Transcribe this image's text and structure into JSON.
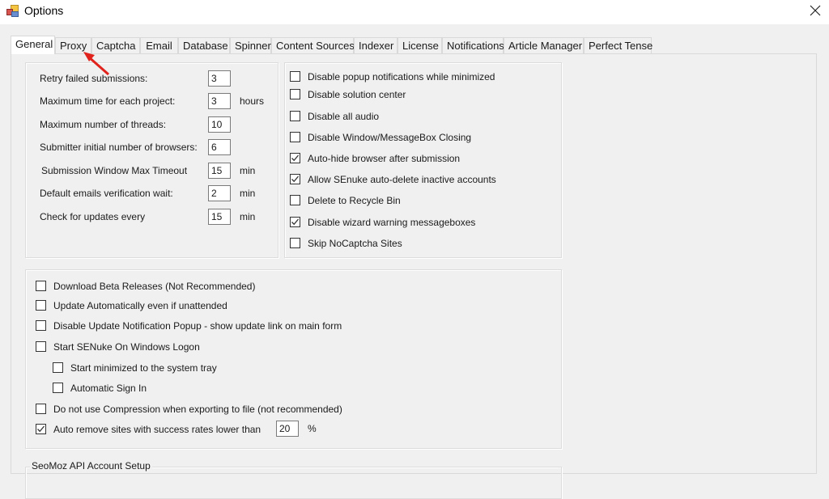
{
  "window": {
    "title": "Options",
    "icon": "options-app-icon",
    "close_icon": "close-icon"
  },
  "tabs": [
    {
      "label": "General",
      "active": true
    },
    {
      "label": "Proxy",
      "active": false
    },
    {
      "label": "Captcha",
      "active": false
    },
    {
      "label": "Email",
      "active": false
    },
    {
      "label": "Database",
      "active": false
    },
    {
      "label": "Spinner",
      "active": false
    },
    {
      "label": "Content Sources",
      "active": false
    },
    {
      "label": "Indexer",
      "active": false
    },
    {
      "label": "License",
      "active": false
    },
    {
      "label": "Notifications",
      "active": false
    },
    {
      "label": "Article Manager",
      "active": false
    },
    {
      "label": "Perfect Tense",
      "active": false
    }
  ],
  "settings": [
    {
      "label": "Retry failed submissions:",
      "value": "3",
      "unit": ""
    },
    {
      "label": "Maximum time for each project:",
      "value": "3",
      "unit": "hours"
    },
    {
      "label": "Maximum number of threads:",
      "value": "10",
      "unit": ""
    },
    {
      "label": "Submitter initial number of browsers:",
      "value": "6",
      "unit": ""
    },
    {
      "label": "Submission Window Max Timeout",
      "value": "15",
      "unit": "min"
    },
    {
      "label": "Default emails verification wait:",
      "value": "2",
      "unit": "min"
    },
    {
      "label": "Check for updates every",
      "value": "15",
      "unit": "min"
    }
  ],
  "general_options": [
    {
      "label": "Disable popup notifications while minimized",
      "checked": false
    },
    {
      "label": "Disable solution center",
      "checked": false
    },
    {
      "label": "Disable all audio",
      "checked": false
    },
    {
      "label": "Disable Window/MessageBox Closing",
      "checked": false
    },
    {
      "label": "Auto-hide browser after submission",
      "checked": true
    },
    {
      "label": "Allow SEnuke auto-delete inactive accounts",
      "checked": true
    },
    {
      "label": "Delete to Recycle Bin",
      "checked": false
    },
    {
      "label": "Disable wizard warning messageboxes",
      "checked": true
    },
    {
      "label": "Skip NoCaptcha Sites",
      "checked": false
    }
  ],
  "update_options": [
    {
      "label": "Download Beta Releases (Not Recommended)",
      "checked": false,
      "indent": false
    },
    {
      "label": "Update Automatically even if unattended",
      "checked": false,
      "indent": false
    },
    {
      "label": "Disable Update Notification Popup - show update link on main form",
      "checked": false,
      "indent": false
    },
    {
      "label": "Start SENuke On Windows Logon",
      "checked": false,
      "indent": false
    },
    {
      "label": "Start minimized to the system tray",
      "checked": false,
      "indent": true
    },
    {
      "label": "Automatic Sign In",
      "checked": false,
      "indent": true
    },
    {
      "label": "Do not use Compression when exporting to file (not recommended)",
      "checked": false,
      "indent": false
    },
    {
      "label": "Auto remove sites with success rates lower than",
      "checked": true,
      "indent": false
    }
  ],
  "auto_remove": {
    "value": "20",
    "unit": "%"
  },
  "seomoz_group": {
    "title": "SeoMoz API Account Setup"
  },
  "annotation": {
    "type": "red-arrow",
    "points_to": "Proxy",
    "color": "#e0231c"
  },
  "colors": {
    "window_bg": "#f0f0f0",
    "titlebar_bg": "#ffffff",
    "arrow": "#e0231c"
  }
}
